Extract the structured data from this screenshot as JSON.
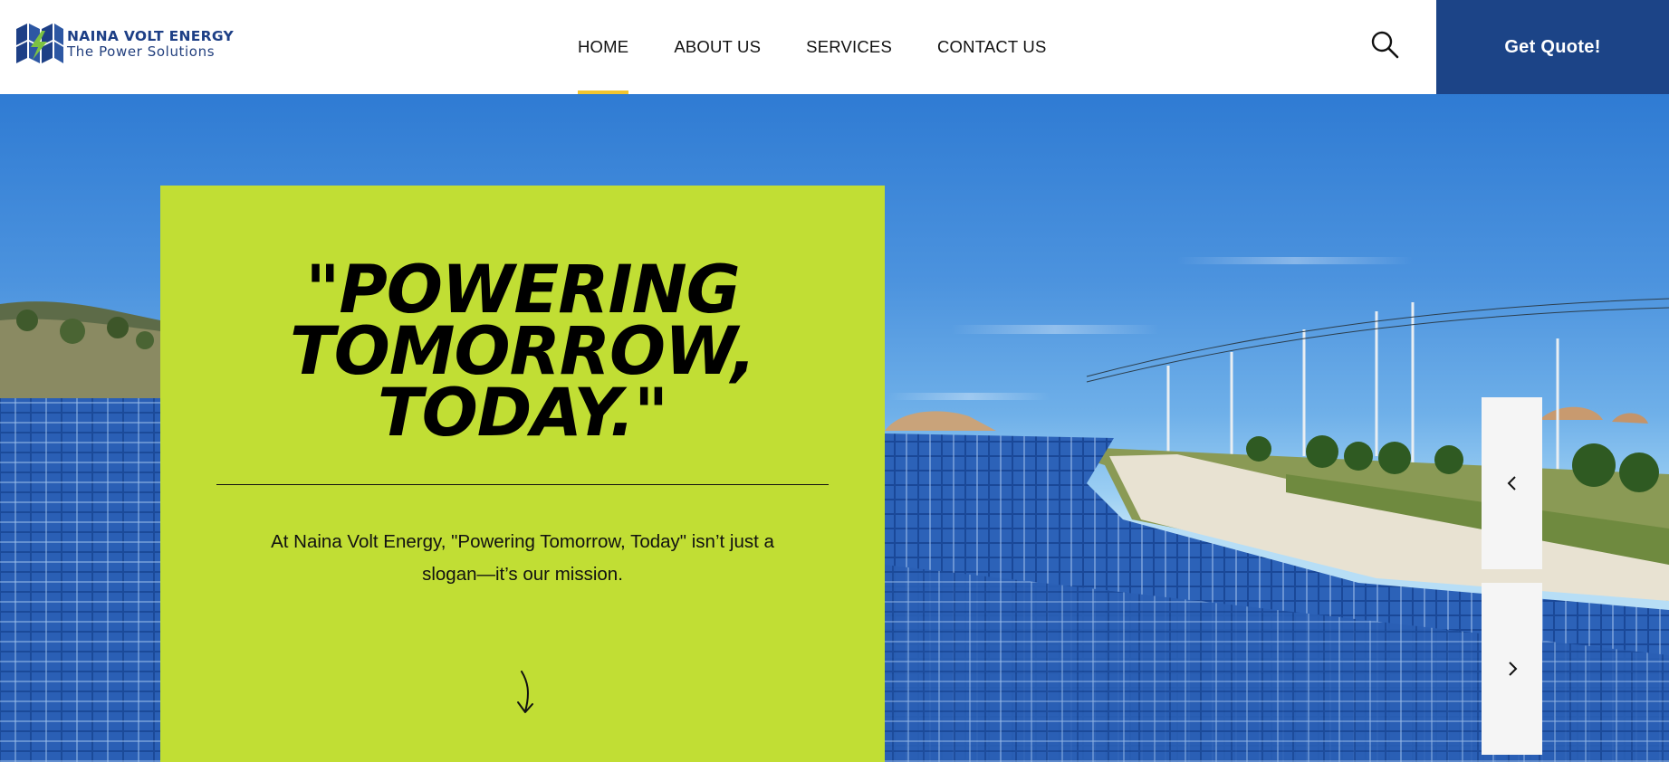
{
  "brand": {
    "name_main": "NAINA ",
    "name_accent": "VOLT ENERGY",
    "tagline": "The Power Solutions",
    "logo_icon": "solar-panel-bolt-logo"
  },
  "nav": {
    "items": [
      {
        "label": "HOME",
        "active": true
      },
      {
        "label": "ABOUT US",
        "active": false
      },
      {
        "label": "SERVICES",
        "active": false
      },
      {
        "label": "CONTACT US",
        "active": false
      }
    ],
    "search_icon": "search-icon",
    "quote_label": "Get Quote!"
  },
  "hero": {
    "title": "\"POWERING\nTOMORROW,\nTODAY.\"",
    "description": "At Naina Volt Energy, \"Powering Tomorrow, Today\" isn’t just a slogan—it’s our mission.",
    "scroll_icon": "arrow-down-icon",
    "prev_icon": "chevron-left-icon",
    "next_icon": "chevron-right-icon"
  },
  "colors": {
    "brand_blue": "#1c4487",
    "accent_green": "#c1de34",
    "active_underline": "#f2c52f",
    "logo_green": "#7cc242"
  }
}
